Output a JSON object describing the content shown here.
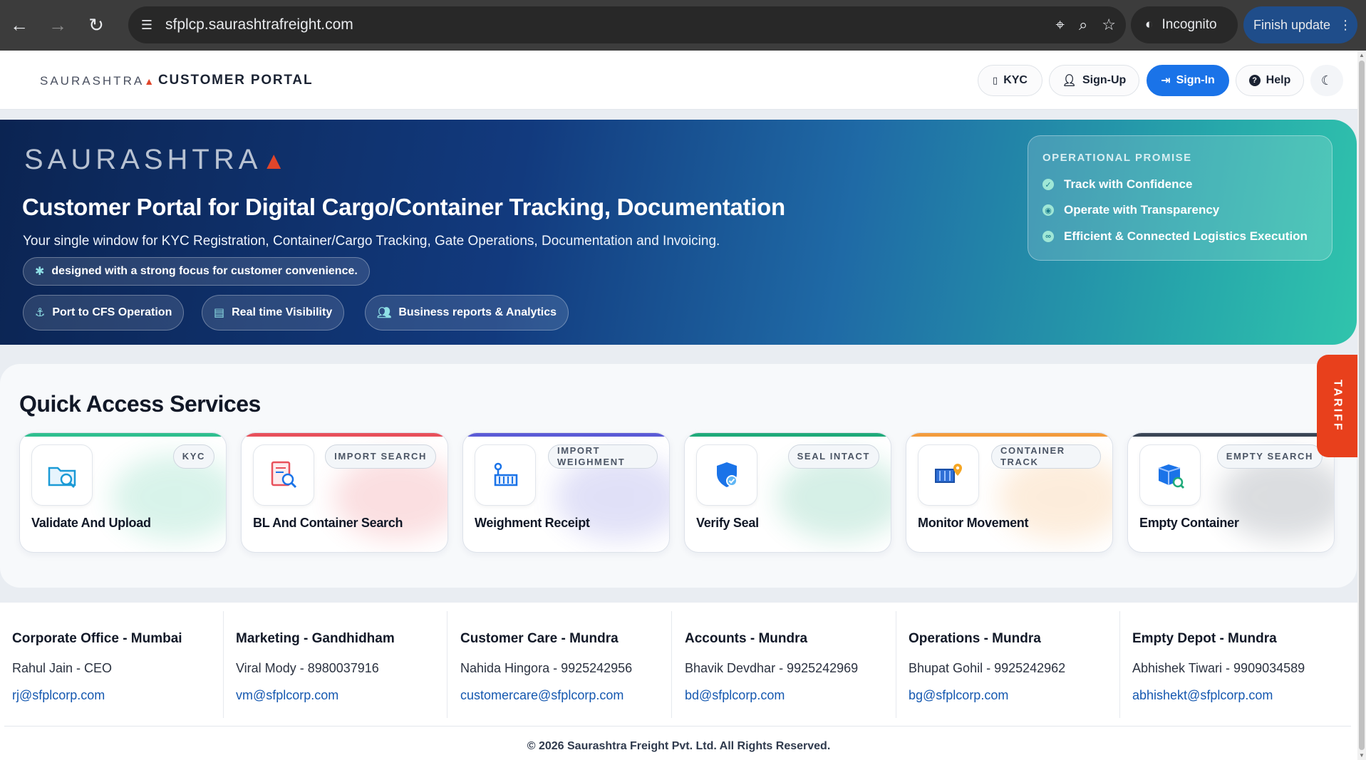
{
  "browser": {
    "url": "sfplcp.saurashtrafreight.com",
    "incognito_label": "Incognito",
    "update_label": "Finish update"
  },
  "header": {
    "brand": "SAURASHTRA",
    "portal_title": "CUSTOMER PORTAL",
    "buttons": {
      "kyc": "KYC",
      "signup": "Sign-Up",
      "signin": "Sign-In",
      "help": "Help"
    },
    "accent_color": "#1a73e8"
  },
  "hero": {
    "brand": "SAURASHTRA",
    "title": "Customer Portal for Digital Cargo/Container Tracking, Documentation",
    "subtitle": "Your single window for KYC Registration, Container/Cargo Tracking, Gate Operations, Documentation and Invoicing.",
    "focus_badge": "designed with a strong focus for customer convenience.",
    "pills": [
      "Port to CFS Operation",
      "Real time Visibility",
      "Business reports & Analytics"
    ],
    "promise": {
      "heading": "OPERATIONAL PROMISE",
      "items": [
        "Track with Confidence",
        "Operate with Transparency",
        "Efficient & Connected Logistics Execution"
      ]
    }
  },
  "quick_access": {
    "title": "Quick Access Services",
    "cards": [
      {
        "badge": "KYC",
        "label": "Validate And Upload",
        "icon": "folder-search-icon",
        "color": "#2fbf8f"
      },
      {
        "badge": "IMPORT SEARCH",
        "label": "BL And Container Search",
        "icon": "document-search-icon",
        "color": "#e8505b"
      },
      {
        "badge": "IMPORT WEIGHMENT",
        "label": "Weighment Receipt",
        "icon": "weighbridge-icon",
        "color": "#5b5bd6"
      },
      {
        "badge": "SEAL INTACT",
        "label": "Verify Seal",
        "icon": "shield-check-icon",
        "color": "#1faa7a"
      },
      {
        "badge": "CONTAINER TRACK",
        "label": "Monitor Movement",
        "icon": "container-location-icon",
        "color": "#f39c3d"
      },
      {
        "badge": "EMPTY SEARCH",
        "label": "Empty Container",
        "icon": "container-search-icon",
        "color": "#3b4656"
      }
    ]
  },
  "tariff_label": "TARIFF",
  "footer": {
    "contacts": [
      {
        "title": "Corporate Office - Mumbai",
        "person": "Rahul Jain - CEO",
        "email": "rj@sfplcorp.com"
      },
      {
        "title": "Marketing - Gandhidham",
        "person": "Viral Mody - 8980037916",
        "email": "vm@sfplcorp.com"
      },
      {
        "title": "Customer Care - Mundra",
        "person": "Nahida Hingora - 9925242956",
        "email": "customercare@sfplcorp.com"
      },
      {
        "title": "Accounts - Mundra",
        "person": "Bhavik Devdhar - 9925242969",
        "email": "bd@sfplcorp.com"
      },
      {
        "title": "Operations - Mundra",
        "person": "Bhupat Gohil - 9925242962",
        "email": "bg@sfplcorp.com"
      },
      {
        "title": "Empty Depot - Mundra",
        "person": "Abhishek Tiwari - 9909034589",
        "email": "abhishekt@sfplcorp.com"
      }
    ],
    "copyright": "© 2026 Saurashtra Freight Pvt. Ltd. All Rights Reserved."
  }
}
